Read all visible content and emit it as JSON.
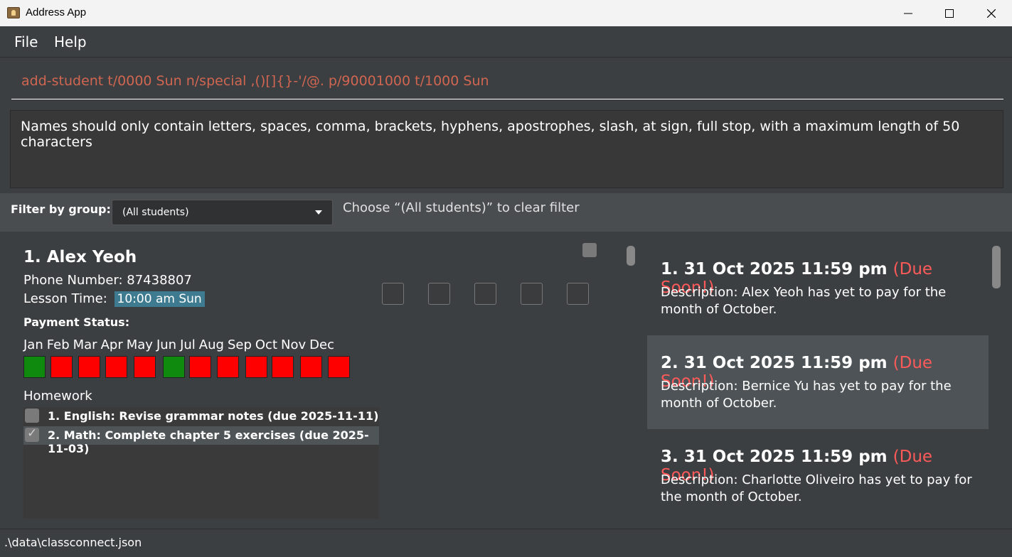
{
  "window": {
    "title": "Address App"
  },
  "menu": {
    "file": "File",
    "help": "Help"
  },
  "command": {
    "value": "add-student t/0000 Sun n/special ,()[]{}-'/@. p/90001000 t/1000 Sun"
  },
  "result": {
    "message": "Names should only contain letters, spaces, comma, brackets, hyphens, apostrophes, slash, at sign, full stop, with a maximum length of 50 characters"
  },
  "filter": {
    "label": "Filter by group:",
    "selected": "(All students)",
    "hint": "Choose “(All students)” to clear filter"
  },
  "student": {
    "name": "1. Alex Yeoh",
    "phone": "Phone Number: 87438807",
    "lesson_label": "Lesson Time:",
    "lesson_time": "10:00 am Sun",
    "payment_label": "Payment Status:",
    "months": [
      "Jan",
      "Feb",
      "Mar",
      "Apr",
      "May",
      "Jun",
      "Jul",
      "Aug",
      "Sep",
      "Oct",
      "Nov",
      "Dec"
    ],
    "payment_paid": [
      true,
      false,
      false,
      false,
      false,
      true,
      false,
      false,
      false,
      false,
      false,
      false
    ],
    "homework_label": "Homework",
    "homework": [
      {
        "text": "1. English: Revise grammar notes (due 2025-11-11)",
        "done": false
      },
      {
        "text": "2. Math: Complete chapter 5 exercises (due 2025-11-03)",
        "done": true
      }
    ]
  },
  "reminders": [
    {
      "title": "1. 31 Oct 2025 11:59 pm",
      "tag": "(Due Soon!)",
      "desc": "Description: Alex Yeoh has yet to pay for the month of October."
    },
    {
      "title": "2. 31 Oct 2025 11:59 pm",
      "tag": "(Due Soon!)",
      "desc": "Description: Bernice Yu has yet to pay for the month of October."
    },
    {
      "title": "3. 31 Oct 2025 11:59 pm",
      "tag": "(Due Soon!)",
      "desc": "Description: Charlotte Oliveiro has yet to pay for the month of October."
    }
  ],
  "status": {
    "path": ".\\data\\classconnect.json"
  },
  "colors": {
    "paid": "#0f8a0f",
    "unpaid": "#ff0000",
    "due": "#ff5a5a",
    "command_text": "#d06651"
  }
}
